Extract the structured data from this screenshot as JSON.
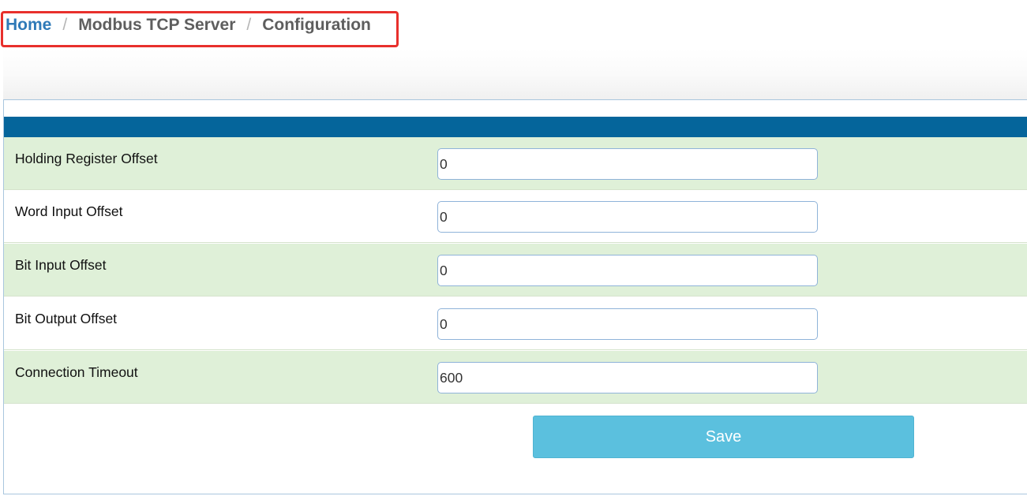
{
  "breadcrumb": {
    "items": [
      "Home",
      "Modbus TCP Server",
      "Configuration"
    ],
    "separator": "/"
  },
  "form": {
    "rows": [
      {
        "label": "Holding Register Offset",
        "value": "0"
      },
      {
        "label": "Word Input Offset",
        "value": "0"
      },
      {
        "label": "Bit Input Offset",
        "value": "0"
      },
      {
        "label": "Bit Output Offset",
        "value": "0"
      },
      {
        "label": "Connection Timeout",
        "value": "600"
      }
    ],
    "save_label": "Save"
  },
  "colors": {
    "header_bar": "#05659b",
    "row_shaded": "#dff0d8",
    "link": "#2f7ab8",
    "save_button": "#5bc0de",
    "highlight": "#e8302c"
  }
}
